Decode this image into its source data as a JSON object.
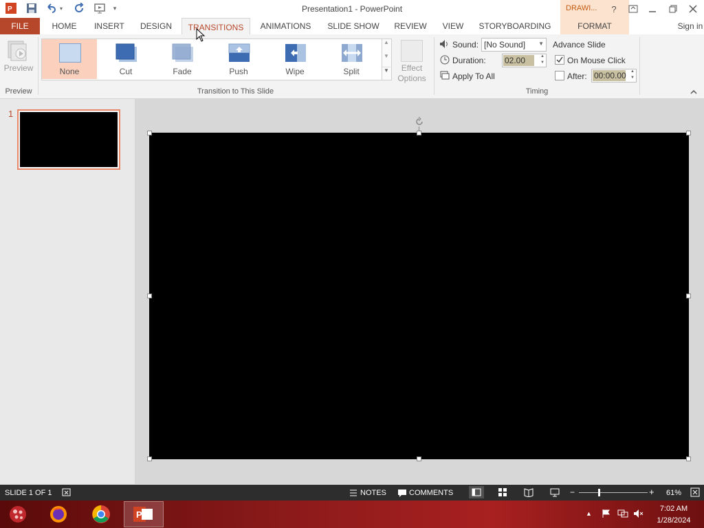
{
  "window": {
    "title": "Presentation1 - PowerPoint",
    "context_tab_group": "DRAWI...",
    "help": "?",
    "sign_in": "Sign in"
  },
  "tabs": [
    "FILE",
    "HOME",
    "INSERT",
    "DESIGN",
    "TRANSITIONS",
    "ANIMATIONS",
    "SLIDE SHOW",
    "REVIEW",
    "VIEW",
    "STORYBOARDING",
    "FORMAT"
  ],
  "active_tab": "TRANSITIONS",
  "ribbon": {
    "preview": {
      "button": "Preview",
      "group": "Preview"
    },
    "transitions": {
      "group": "Transition to This Slide",
      "items": [
        "None",
        "Cut",
        "Fade",
        "Push",
        "Wipe",
        "Split"
      ],
      "selected": "None",
      "effect_options_line1": "Effect",
      "effect_options_line2": "Options"
    },
    "timing": {
      "group": "Timing",
      "sound_label": "Sound:",
      "sound_value": "[No Sound]",
      "duration_label": "Duration:",
      "duration_value": "02.00",
      "apply_all": "Apply To All",
      "advance_label": "Advance Slide",
      "on_mouse_click": "On Mouse Click",
      "on_mouse_click_checked": true,
      "after_label": "After:",
      "after_checked": false,
      "after_value": "00:00.00"
    }
  },
  "thumbnails": [
    {
      "number": "1"
    }
  ],
  "status": {
    "slide_info": "SLIDE 1 OF 1",
    "notes": "NOTES",
    "comments": "COMMENTS",
    "zoom": "61%",
    "zoom_minus": "−",
    "zoom_plus": "+"
  },
  "taskbar": {
    "time": "7:02 AM",
    "date": "1/28/2024"
  },
  "colors": {
    "accent": "#b7472a",
    "selected_transition": "#fbd0bd",
    "statusbar": "#2d2d2d"
  }
}
